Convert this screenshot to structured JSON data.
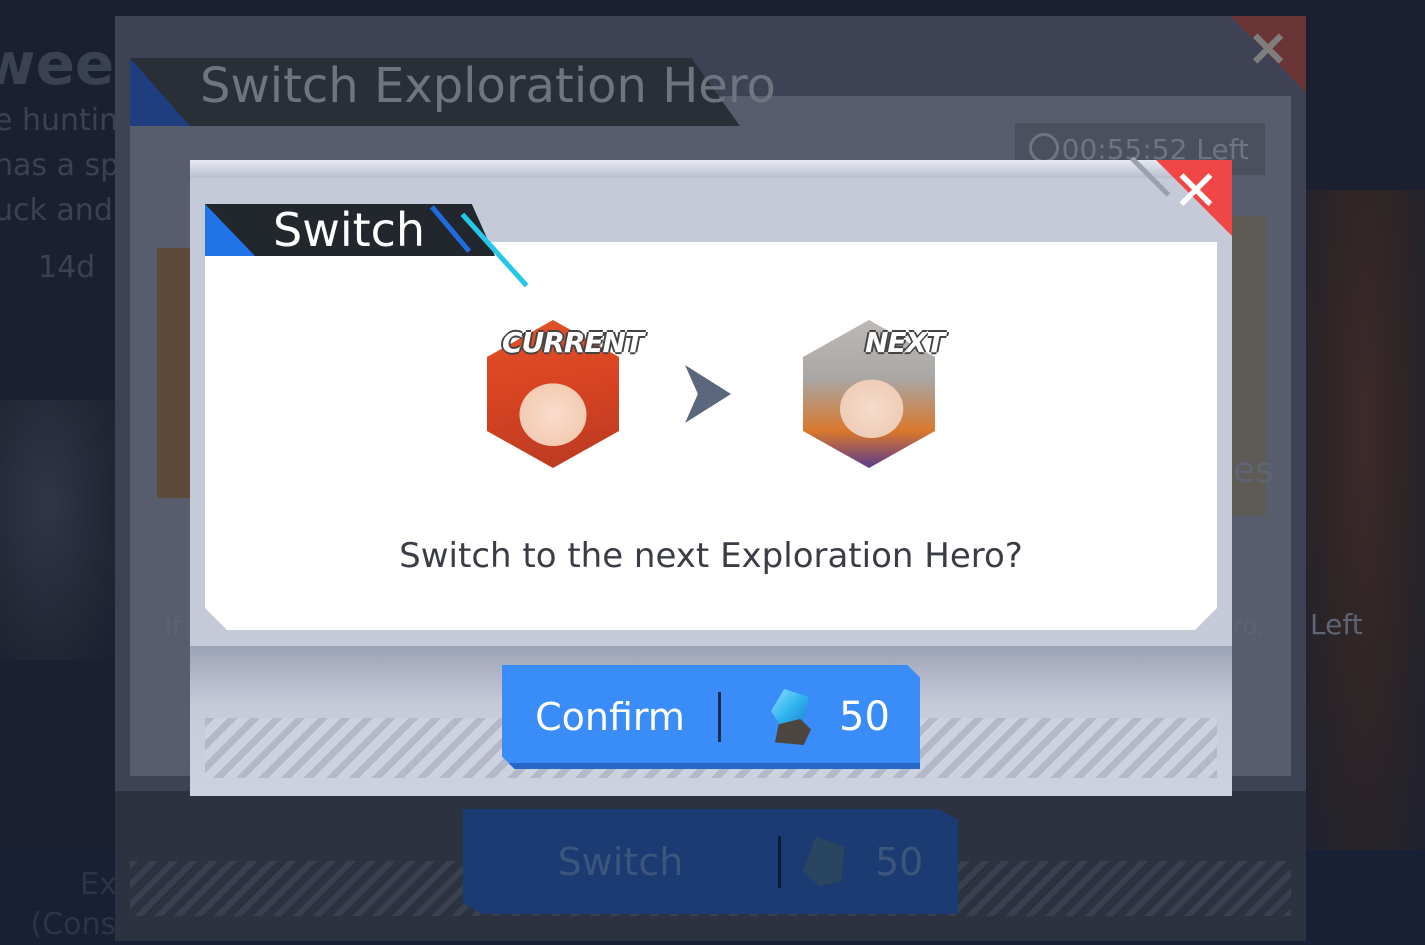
{
  "background": {
    "title_fragment": "wee",
    "lines": [
      "e huntin",
      "nas a sp",
      "uck and"
    ],
    "timer_days": "14d",
    "hint_left": "If",
    "hint_right": "ro.",
    "left_label": "Left",
    "edge_text_es": "es",
    "bottom_left_text": [
      "Ex",
      "(Cons"
    ]
  },
  "back_dialog": {
    "title": "Switch Exploration Hero",
    "timer": "00:55:52 Left",
    "switch_button": {
      "label": "Switch",
      "cost": "50"
    }
  },
  "dialog": {
    "title": "Switch",
    "current_tag": "CURRENT",
    "next_tag": "NEXT",
    "prompt": "Switch to the next Exploration Hero?",
    "confirm": {
      "label": "Confirm",
      "cost": "50",
      "currency_icon": "crystal-gem-icon"
    }
  },
  "colors": {
    "accent_blue": "#3a8cf8",
    "close_red": "#f04646",
    "title_accent": "#2373e8",
    "cyan_stripe": "#25c8e8"
  }
}
